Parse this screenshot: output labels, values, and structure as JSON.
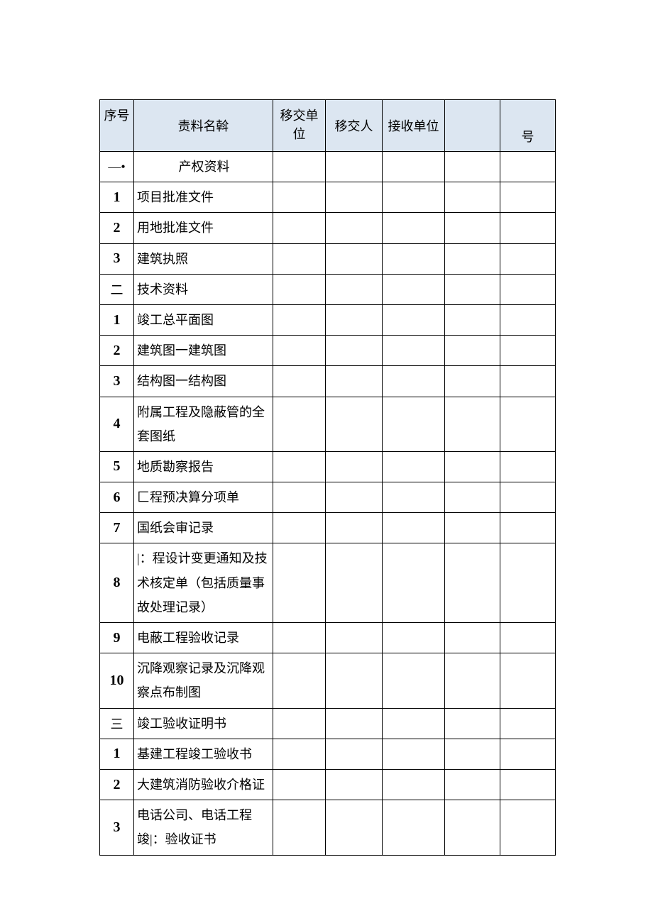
{
  "headers": {
    "seq": "序号",
    "name": "责料名斡",
    "handover_unit": "移交单位",
    "handover_person": "移交人",
    "receive_unit": "接收单位",
    "hao": "号"
  },
  "rows": [
    {
      "seq_html": "—•",
      "seq_class": "zh",
      "name": "产权资料",
      "name_center": true
    },
    {
      "seq_html": "1",
      "name": "项目批准文件"
    },
    {
      "seq_html": "2",
      "name": "用地批准文件"
    },
    {
      "seq_html": "3",
      "name": "建筑执照"
    },
    {
      "seq_html": "二",
      "seq_class": "zh",
      "name": "技术资料"
    },
    {
      "seq_html": "1",
      "name": "竣工总平面图"
    },
    {
      "seq_html": "2",
      "name": "建筑图一建筑图"
    },
    {
      "seq_html": "3",
      "name": "结构图一结构图"
    },
    {
      "seq_html": "4",
      "name": "附属工程及隐蔽管的全套图纸"
    },
    {
      "seq_html": "5",
      "name": "地质勘察报告"
    },
    {
      "seq_html": "6",
      "name": "匚程预决算分项单"
    },
    {
      "seq_html": "7",
      "name": "国纸会审记录"
    },
    {
      "seq_html": "8",
      "name": "|：程设计变更通知及技术核定单（包括质量事故处理记录）"
    },
    {
      "seq_html": "9",
      "name": "电蔽工程验收记录"
    },
    {
      "seq_html": "10",
      "name": "沉降观察记录及沉降观察点布制图"
    },
    {
      "seq_html": "三",
      "seq_class": "zh",
      "name": "竣工验收证明书"
    },
    {
      "seq_html": "1",
      "name": "基建工程竣工验收书"
    },
    {
      "seq_html": "2",
      "name": "大建筑消防验收介格证"
    },
    {
      "seq_html": "3",
      "name": "电话公司、电话工程竣|：验收证书"
    }
  ]
}
